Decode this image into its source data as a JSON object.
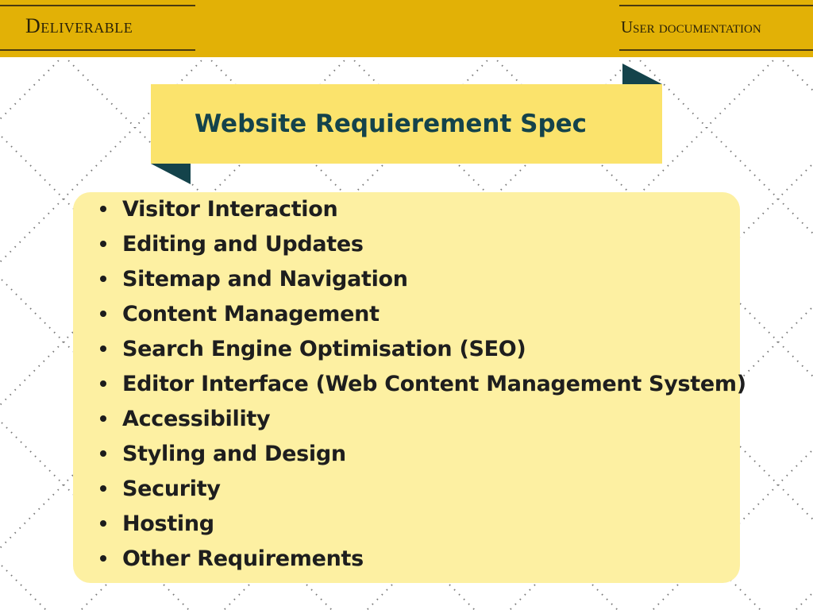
{
  "header": {
    "left_label": "Deliverable",
    "right_label": "User documentation",
    "band_color": "#e2b106"
  },
  "ribbon": {
    "title": "Website Requierement Spec",
    "fill_color": "#fbe36c",
    "fold_color": "#14434b"
  },
  "requirements": {
    "items": [
      {
        "label": "Visitor Interaction"
      },
      {
        "label": "Editing and Updates"
      },
      {
        "label": "Sitemap and Navigation"
      },
      {
        "label": "Content Management"
      },
      {
        "label": "Search Engine Optimisation (SEO)"
      },
      {
        "label": "Editor Interface (Web Content Management System)"
      },
      {
        "label": "Accessibility"
      },
      {
        "label": "Styling and Design"
      },
      {
        "label": "Security"
      },
      {
        "label": "Hosting"
      },
      {
        "label": "Other Requirements"
      }
    ],
    "box_color": "#fdf0a2"
  }
}
